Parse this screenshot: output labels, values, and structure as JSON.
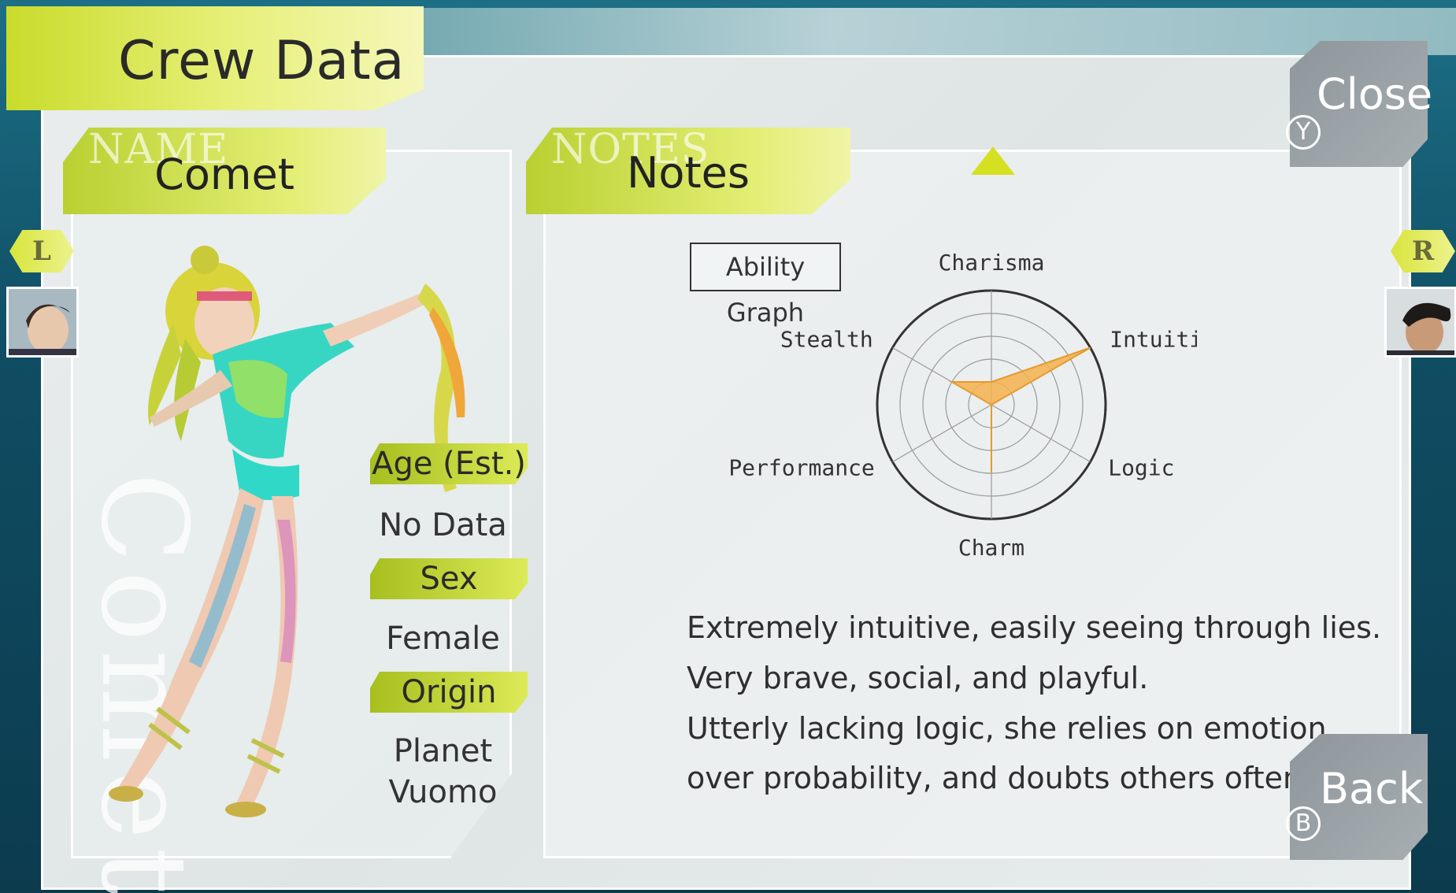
{
  "header": {
    "title": "Crew Data"
  },
  "name_panel": {
    "ghost_label": "NAME",
    "value": "Comet",
    "vertical_name": "Comet"
  },
  "notes_panel": {
    "ghost_label": "NOTES",
    "value": "Notes"
  },
  "info": {
    "age_label": "Age (Est.)",
    "age_value": "No Data",
    "sex_label": "Sex",
    "sex_value": "Female",
    "origin_label": "Origin",
    "origin_value_1": "Planet",
    "origin_value_2": "Vuomo"
  },
  "nav": {
    "prev_key": "L",
    "next_key": "R"
  },
  "buttons": {
    "close_label": "Close",
    "close_key": "Y",
    "back_label": "Back",
    "back_key": "B"
  },
  "graph": {
    "title": "Ability Graph"
  },
  "chart_data": {
    "type": "radar",
    "title": "",
    "axes": [
      "Charisma",
      "Intuition",
      "Logic",
      "Charm",
      "Performance",
      "Stealth"
    ],
    "max": 5,
    "series": [
      {
        "values": [
          1,
          5,
          0,
          3,
          0,
          2
        ]
      }
    ],
    "colors": {
      "fill": "#f6b24f",
      "stroke": "#e59a2e",
      "grid": "#777777",
      "outer": "#333333"
    }
  },
  "description": {
    "line1": "Extremely intuitive, easily seeing through lies.",
    "line2": "Very brave, social, and playful.",
    "line3": "Utterly lacking logic, she relies on emotion",
    "line4": "over probability, and doubts others often."
  }
}
